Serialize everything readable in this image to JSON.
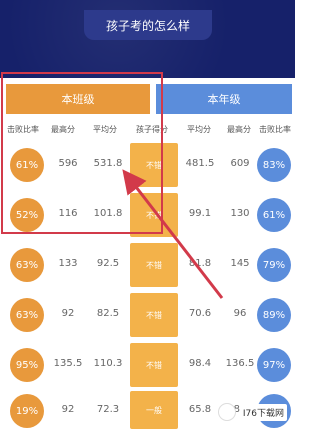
{
  "header": {
    "title": "孩子考的怎么样"
  },
  "tabs": {
    "class_label": "本班级",
    "grade_label": "本年级"
  },
  "columns": {
    "left": [
      "击败比率",
      "最高分",
      "平均分",
      "孩子得分"
    ],
    "right": [
      "平均分",
      "最高分",
      "击败比率"
    ]
  },
  "rows": [
    {
      "left_rate": "61%",
      "left_max": "596",
      "left_avg": "531.8",
      "tag": "不错",
      "right_avg": "481.5",
      "right_max": "609",
      "right_rate": "83%"
    },
    {
      "left_rate": "52%",
      "left_max": "116",
      "left_avg": "101.8",
      "tag": "不错",
      "right_avg": "99.1",
      "right_max": "130",
      "right_rate": "61%"
    },
    {
      "left_rate": "63%",
      "left_max": "133",
      "left_avg": "92.5",
      "tag": "不错",
      "right_avg": "81.8",
      "right_max": "145",
      "right_rate": "79%"
    },
    {
      "left_rate": "63%",
      "left_max": "92",
      "left_avg": "82.5",
      "tag": "不错",
      "right_avg": "70.6",
      "right_max": "96",
      "right_rate": "89%"
    },
    {
      "left_rate": "95%",
      "left_max": "135.5",
      "left_avg": "110.3",
      "tag": "不错",
      "right_avg": "98.4",
      "right_max": "136.5",
      "right_rate": "97%"
    },
    {
      "left_rate": "19%",
      "left_max": "92",
      "left_avg": "72.3",
      "tag": "一般",
      "right_avg": "65.8",
      "right_max": "88",
      "right_rate": "24%"
    }
  ],
  "watermark": {
    "text": "I76下载网"
  },
  "colors": {
    "header": "#16216a",
    "orange": "#e8993c",
    "blue": "#5b8ddb",
    "highlight": "#d23a4a"
  }
}
